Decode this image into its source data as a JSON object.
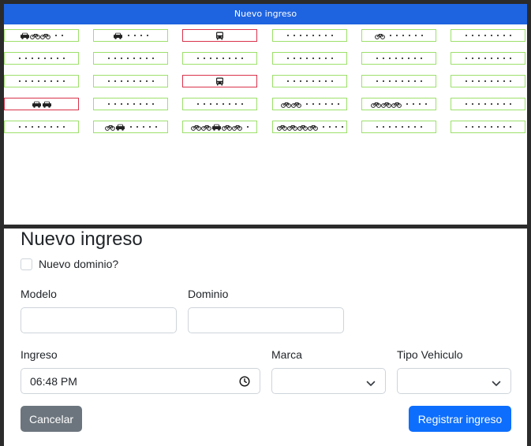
{
  "header": {
    "title": "Nuevo ingreso"
  },
  "grid": {
    "rows": [
      [
        {
          "occupied": false,
          "vehicles": [
            "car",
            "bike",
            "bike"
          ],
          "empty": 2
        },
        {
          "occupied": false,
          "vehicles": [
            "car"
          ],
          "empty": 4
        },
        {
          "occupied": true,
          "vehicles": [
            "bus"
          ],
          "empty": 0
        },
        {
          "occupied": false,
          "vehicles": [],
          "empty": 8
        },
        {
          "occupied": false,
          "vehicles": [
            "bike"
          ],
          "empty": 6
        },
        {
          "occupied": false,
          "vehicles": [],
          "empty": 8
        }
      ],
      [
        {
          "occupied": false,
          "vehicles": [],
          "empty": 8
        },
        {
          "occupied": false,
          "vehicles": [],
          "empty": 8
        },
        {
          "occupied": false,
          "vehicles": [],
          "empty": 8
        },
        {
          "occupied": false,
          "vehicles": [],
          "empty": 8
        },
        {
          "occupied": false,
          "vehicles": [],
          "empty": 8
        },
        {
          "occupied": false,
          "vehicles": [],
          "empty": 8
        }
      ],
      [
        {
          "occupied": false,
          "vehicles": [],
          "empty": 8
        },
        {
          "occupied": false,
          "vehicles": [],
          "empty": 8
        },
        {
          "occupied": true,
          "vehicles": [
            "bus"
          ],
          "empty": 0
        },
        {
          "occupied": false,
          "vehicles": [],
          "empty": 8
        },
        {
          "occupied": false,
          "vehicles": [],
          "empty": 8
        },
        {
          "occupied": false,
          "vehicles": [],
          "empty": 8
        }
      ],
      [
        {
          "occupied": true,
          "vehicles": [
            "car",
            "car"
          ],
          "empty": 0
        },
        {
          "occupied": false,
          "vehicles": [],
          "empty": 8
        },
        {
          "occupied": false,
          "vehicles": [],
          "empty": 8
        },
        {
          "occupied": false,
          "vehicles": [
            "bike",
            "bike"
          ],
          "empty": 6
        },
        {
          "occupied": false,
          "vehicles": [
            "bike",
            "bike",
            "bike"
          ],
          "empty": 4
        },
        {
          "occupied": false,
          "vehicles": [],
          "empty": 8
        }
      ],
      [
        {
          "occupied": false,
          "vehicles": [],
          "empty": 8
        },
        {
          "occupied": false,
          "vehicles": [
            "bike",
            "car"
          ],
          "empty": 5
        },
        {
          "occupied": false,
          "vehicles": [
            "bike",
            "bike",
            "car",
            "bike",
            "bike"
          ],
          "empty": 1
        },
        {
          "occupied": false,
          "vehicles": [
            "bike",
            "bike",
            "bike",
            "bike"
          ],
          "empty": 4
        },
        {
          "occupied": false,
          "vehicles": [],
          "empty": 8
        },
        {
          "occupied": false,
          "vehicles": [],
          "empty": 8
        }
      ]
    ]
  },
  "form": {
    "title": "Nuevo ingreso",
    "new_domain_label": "Nuevo dominio?",
    "new_domain_checked": false,
    "modelo_label": "Modelo",
    "modelo_value": "",
    "dominio_label": "Dominio",
    "dominio_value": "",
    "ingreso_label": "Ingreso",
    "ingreso_value": "06:48 PM",
    "marca_label": "Marca",
    "marca_value": "",
    "tipo_label": "Tipo Vehiculo",
    "tipo_value": "",
    "cancel_label": "Cancelar",
    "submit_label": "Registrar ingreso"
  }
}
